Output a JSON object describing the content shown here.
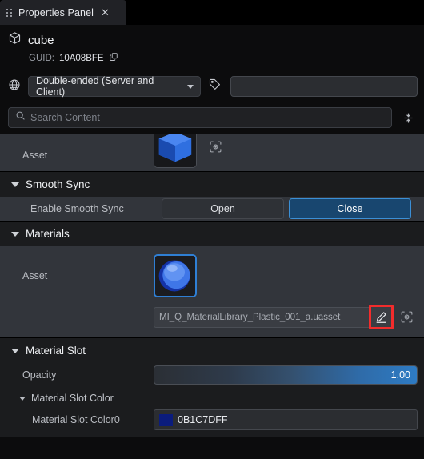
{
  "tab": {
    "title": "Properties Panel",
    "drag_handle_icon": "drag-dots-icon",
    "close_icon": "close-icon"
  },
  "object_header": {
    "icon": "cube-icon",
    "name": "cube",
    "guid_label": "GUID:",
    "guid_value": "10A08BFE",
    "copy_icon": "copy-icon"
  },
  "network": {
    "globe_icon": "globe-icon",
    "mode": "Double-ended (Server and Client)",
    "tag_icon": "tag-icon",
    "tag_value": ""
  },
  "search": {
    "icon": "search-icon",
    "placeholder": "Search Content",
    "value": "",
    "collapse_icon": "collapse-all-icon"
  },
  "top_asset": {
    "label": "Asset",
    "thumbnail": "cube-thumbnail",
    "locate_icon": "locate-icon"
  },
  "smooth_sync": {
    "title": "Smooth Sync",
    "row_label": "Enable Smooth Sync",
    "open_label": "Open",
    "close_label": "Close",
    "selected": "Close"
  },
  "materials": {
    "title": "Materials",
    "asset_label": "Asset",
    "thumbnail": "sphere-thumbnail",
    "asset_path": "MI_Q_MaterialLibrary_Plastic_001_a.uasset",
    "edit_icon": "edit-pencil-icon",
    "locate_icon": "locate-icon",
    "highlight_color": "#f22c2c"
  },
  "material_slot": {
    "title": "Material Slot",
    "opacity_label": "Opacity",
    "opacity_value": "1.00",
    "color_group_title": "Material Slot Color",
    "color_row_label": "Material Slot Color0",
    "color_hex_text": "0B1C7DFF",
    "color_swatch": "#0b1c7d"
  },
  "theme": {
    "accent": "#2f7fd4",
    "panel_bg": "#0c0c0d",
    "card_bg": "#32353b",
    "section_bg": "#1b1c1e"
  }
}
